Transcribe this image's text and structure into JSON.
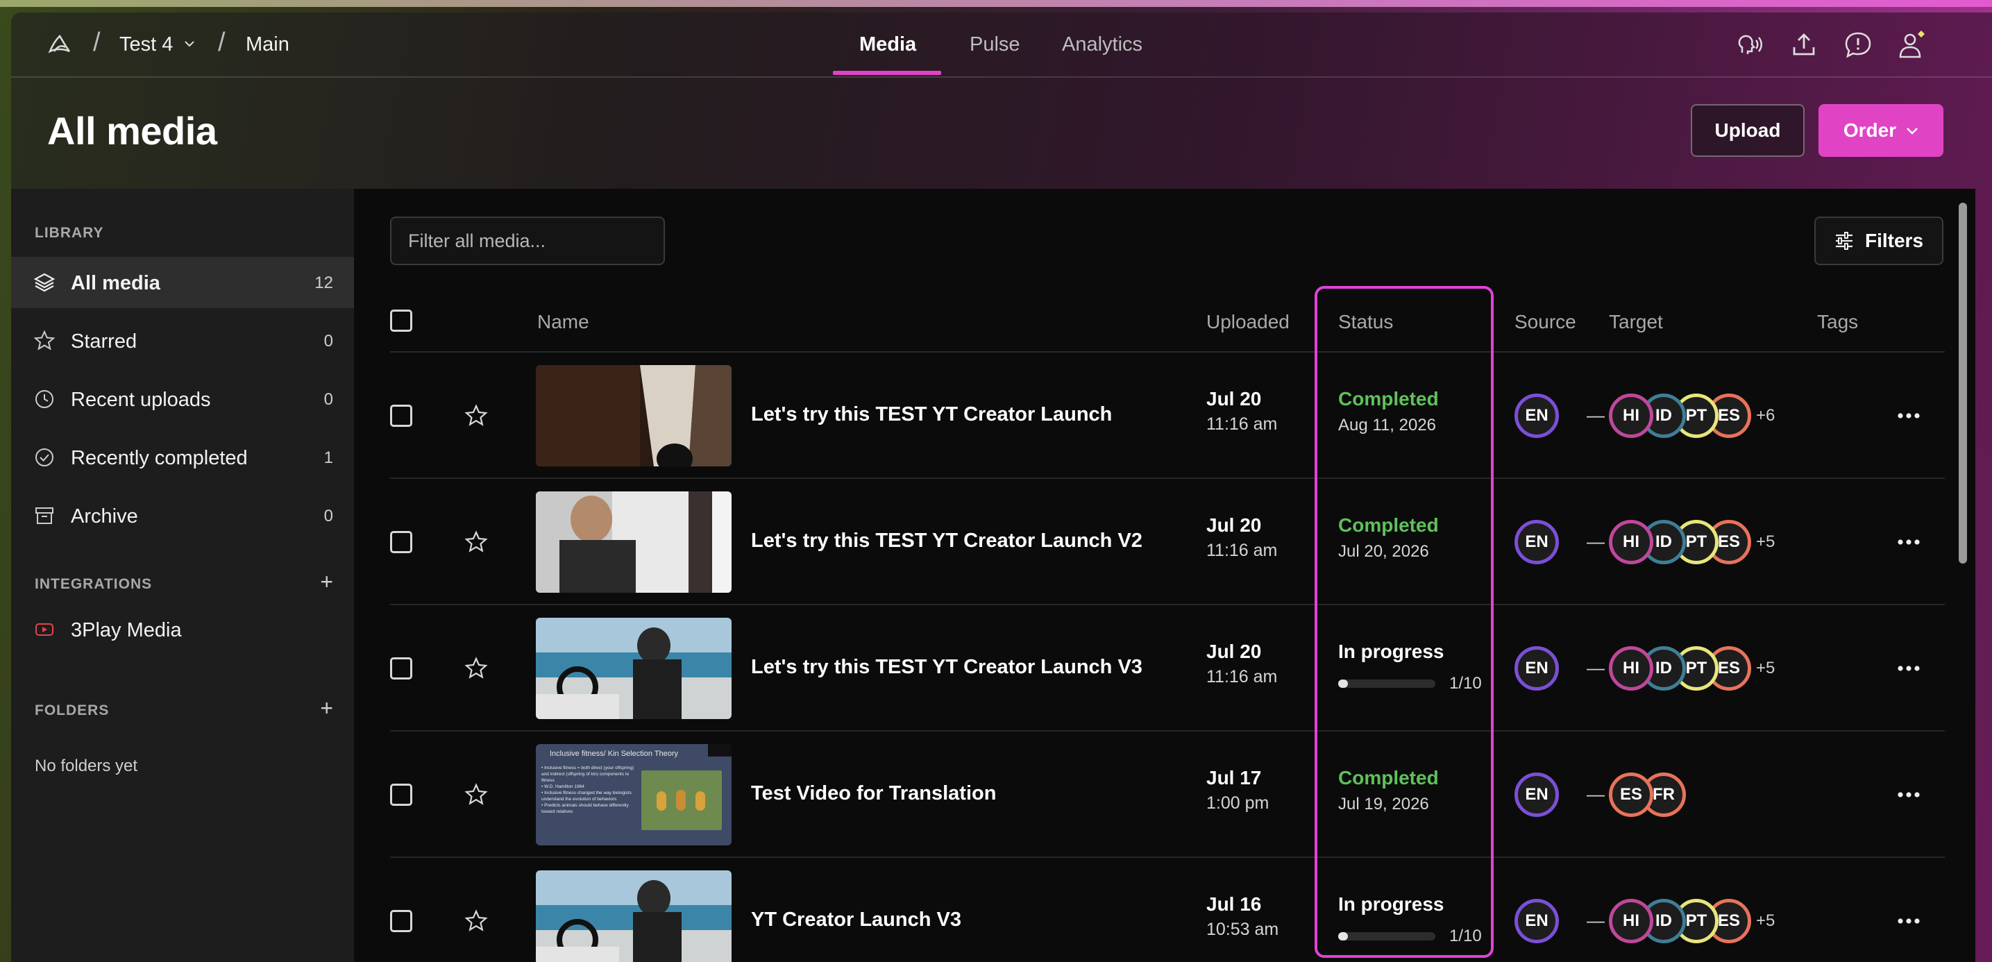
{
  "breadcrumb": {
    "workspace": "Test 4",
    "page": "Main"
  },
  "nav_tabs": [
    {
      "label": "Media",
      "active": true
    },
    {
      "label": "Pulse",
      "active": false
    },
    {
      "label": "Analytics",
      "active": false
    }
  ],
  "header": {
    "title": "All media",
    "upload_label": "Upload",
    "order_label": "Order"
  },
  "sidebar": {
    "library_heading": "LIBRARY",
    "items": [
      {
        "label": "All media",
        "count": "12",
        "icon": "layers-icon",
        "active": true
      },
      {
        "label": "Starred",
        "count": "0",
        "icon": "star-icon",
        "active": false
      },
      {
        "label": "Recent uploads",
        "count": "0",
        "icon": "clock-icon",
        "active": false
      },
      {
        "label": "Recently completed",
        "count": "1",
        "icon": "check-circle-icon",
        "active": false
      },
      {
        "label": "Archive",
        "count": "0",
        "icon": "archive-icon",
        "active": false
      }
    ],
    "integrations_heading": "INTEGRATIONS",
    "integration": "3Play Media",
    "folders_heading": "FOLDERS",
    "no_folders": "No folders yet"
  },
  "toolbar": {
    "filter_placeholder": "Filter all media...",
    "filters_label": "Filters"
  },
  "table": {
    "columns": {
      "name": "Name",
      "uploaded": "Uploaded",
      "status": "Status",
      "source": "Source",
      "target": "Target",
      "tags": "Tags"
    },
    "rows": [
      {
        "name": "Let's try this TEST YT Creator Launch",
        "date": "Jul 20",
        "time": "11:16 am",
        "status": "Completed",
        "status_detail": "Aug 11, 2026",
        "progress": null,
        "source": "EN",
        "targets": [
          "HI",
          "ID",
          "PT",
          "ES"
        ],
        "more": "+6",
        "tags": "—"
      },
      {
        "name": "Let's try this TEST YT Creator Launch V2",
        "date": "Jul 20",
        "time": "11:16 am",
        "status": "Completed",
        "status_detail": "Jul 20, 2026",
        "progress": null,
        "source": "EN",
        "targets": [
          "HI",
          "ID",
          "PT",
          "ES"
        ],
        "more": "+5",
        "tags": "—"
      },
      {
        "name": "Let's try this TEST YT Creator Launch V3",
        "date": "Jul 20",
        "time": "11:16 am",
        "status": "In progress",
        "status_detail": "1/10",
        "progress": 0.1,
        "source": "EN",
        "targets": [
          "HI",
          "ID",
          "PT",
          "ES"
        ],
        "more": "+5",
        "tags": "—"
      },
      {
        "name": "Test Video for Translation",
        "date": "Jul 17",
        "time": "1:00 pm",
        "status": "Completed",
        "status_detail": "Jul 19, 2026",
        "progress": null,
        "source": "EN",
        "targets": [
          "ES",
          "FR"
        ],
        "more": "",
        "tags": "—"
      },
      {
        "name": "YT Creator Launch V3",
        "date": "Jul 16",
        "time": "10:53 am",
        "status": "In progress",
        "status_detail": "1/10",
        "progress": 0.1,
        "source": "EN",
        "targets": [
          "HI",
          "ID",
          "PT",
          "ES"
        ],
        "more": "+5",
        "tags": "—"
      }
    ],
    "slide_thumb": {
      "title": "Inclusive fitness/ Kin Selection Theory",
      "bullets": [
        "Inclusive fitness = both direct (your offspring) and indirect (offspring of kin) components to fitness",
        "W.D. Hamilton 1964",
        "Inclusive fitness changed the way biologists understand the evolution of behaviors",
        "Predicts animals should behave differently toward relatives"
      ]
    }
  },
  "colors": {
    "accent": "#e044c4",
    "completed": "#5fc15a",
    "in_progress": "#ffffff",
    "EN": "#7b4fd6",
    "HI": "#c0479b",
    "ID": "#3f7e96",
    "PT": "#e8e67a",
    "ES": "#e8735a",
    "FR": "#e8735a"
  }
}
